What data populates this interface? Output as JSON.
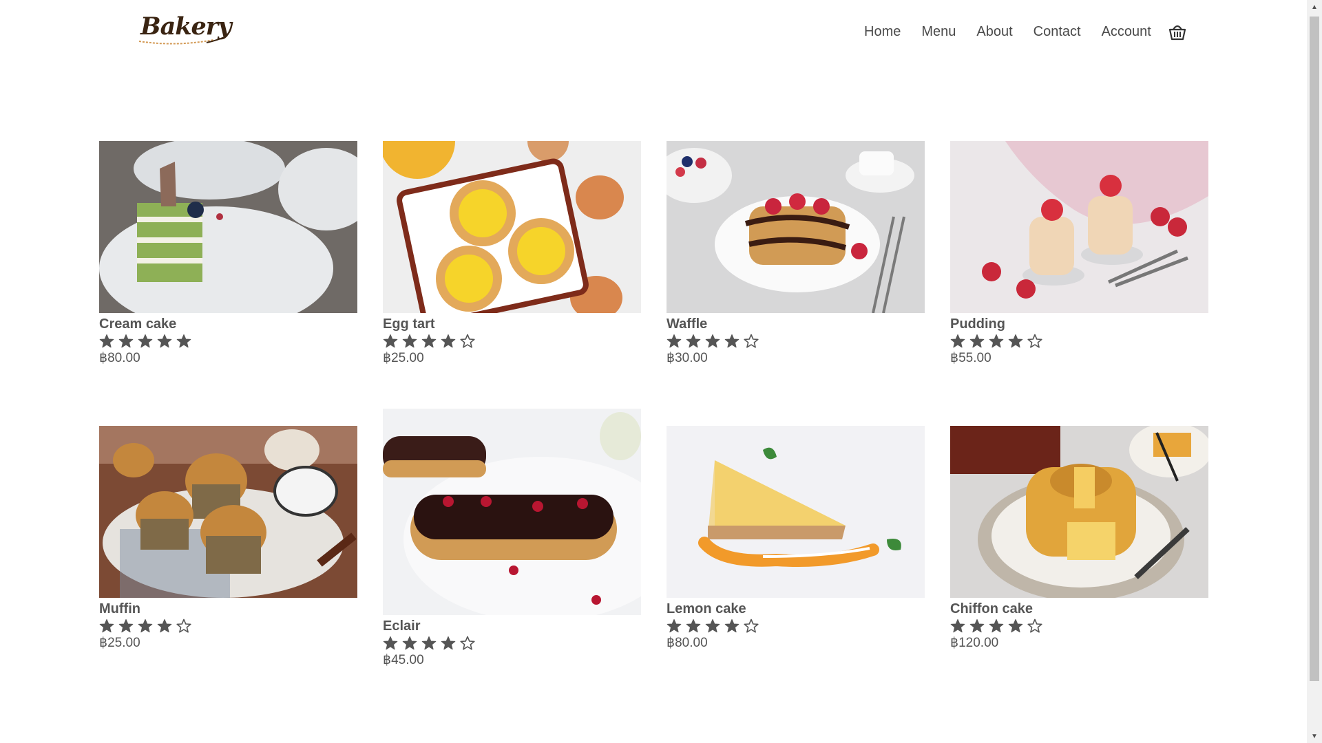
{
  "header": {
    "logo_text": "Bakery",
    "nav": [
      "Home",
      "Menu",
      "About",
      "Contact",
      "Account"
    ],
    "cart_icon": "basket-icon"
  },
  "products": [
    {
      "name": "Cream cake",
      "rating": 5,
      "price": "฿80.00"
    },
    {
      "name": "Egg tart",
      "rating": 4,
      "price": "฿25.00"
    },
    {
      "name": "Waffle",
      "rating": 4,
      "price": "฿30.00"
    },
    {
      "name": "Pudding",
      "rating": 4,
      "price": "฿55.00"
    },
    {
      "name": "Muffin",
      "rating": 4,
      "price": "฿25.00"
    },
    {
      "name": "Eclair",
      "rating": 4,
      "price": "฿45.00"
    },
    {
      "name": "Lemon cake",
      "rating": 4,
      "price": "฿80.00"
    },
    {
      "name": "Chiffon cake",
      "rating": 4,
      "price": "฿120.00"
    }
  ],
  "rating_max": 5,
  "colors": {
    "star": "#555555",
    "text": "#444444",
    "background": "#ffffff"
  }
}
